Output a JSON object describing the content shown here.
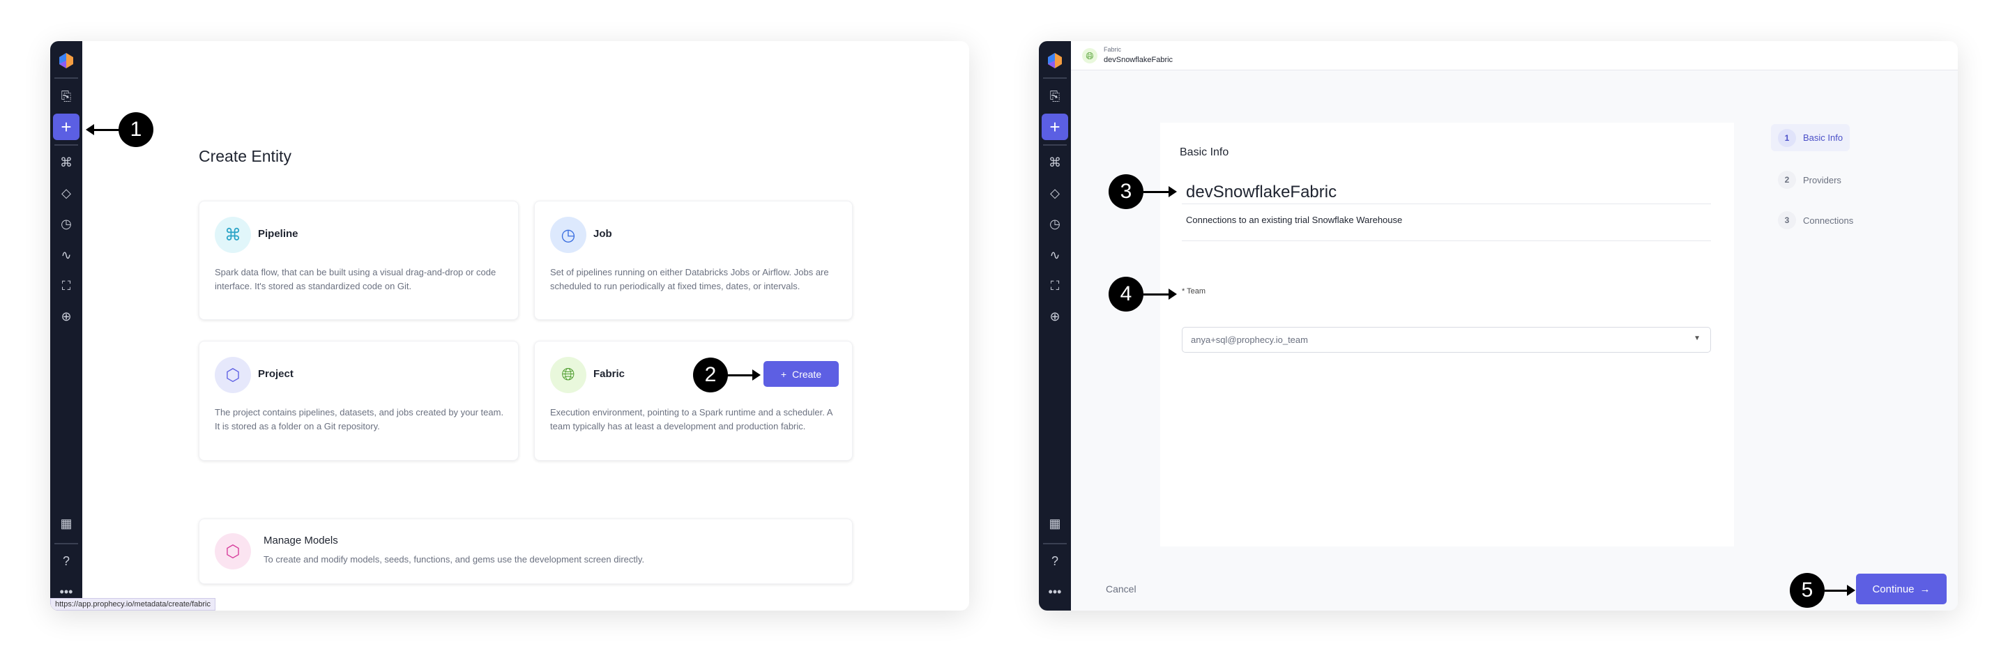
{
  "left": {
    "page_title": "Create Entity",
    "cards": [
      {
        "title": "Pipeline",
        "desc": "Spark data flow, that can be built using a visual drag-and-drop or code interface. It's stored as standardized code on Git.",
        "icon": "pipeline-icon",
        "color": "#e1f6fa"
      },
      {
        "title": "Job",
        "desc": "Set of pipelines running on either Databricks Jobs or Airflow. Jobs are scheduled to run periodically at fixed times, dates, or intervals.",
        "icon": "clock-icon",
        "color": "#dde9fd"
      },
      {
        "title": "Project",
        "desc": "The project contains pipelines, datasets, and jobs created by your team. It is stored as a folder on a Git repository.",
        "icon": "cube-icon",
        "color": "#e6e8fb"
      },
      {
        "title": "Fabric",
        "desc": "Execution environment, pointing to a Spark runtime and a scheduler. A team typically has at least a development and production fabric.",
        "icon": "globe-icon",
        "color": "#e9f8dc"
      }
    ],
    "create_label": "Create",
    "models": {
      "title": "Manage Models",
      "desc": "To create and modify models, seeds, functions, and gems use the development screen directly."
    },
    "status_url": "https://app.prophecy.io/metadata/create/fabric"
  },
  "right": {
    "header_type": "Fabric",
    "header_name": "devSnowflakeFabric",
    "section_title": "Basic Info",
    "name_value": "devSnowflakeFabric",
    "description_value": "Connections to an existing trial Snowflake Warehouse",
    "team_label": "* Team",
    "team_value": "anya+sql@prophecy.io_team",
    "steps": [
      {
        "n": "1",
        "label": "Basic Info"
      },
      {
        "n": "2",
        "label": "Providers"
      },
      {
        "n": "3",
        "label": "Connections"
      }
    ],
    "cancel_label": "Cancel",
    "continue_label": "Continue"
  },
  "callouts": [
    "1",
    "2",
    "3",
    "4",
    "5"
  ],
  "accent": "#5d5fe3"
}
